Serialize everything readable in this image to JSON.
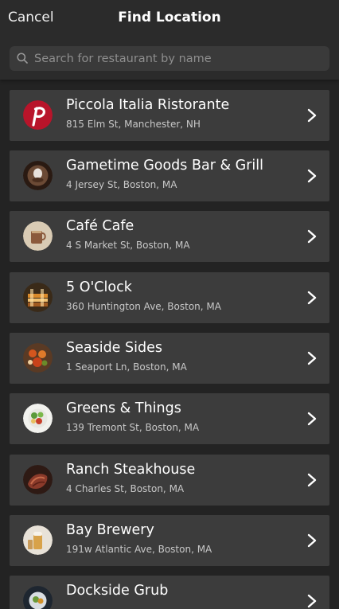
{
  "header": {
    "cancel_label": "Cancel",
    "title": "Find Location"
  },
  "search": {
    "placeholder": "Search for restaurant by name",
    "value": ""
  },
  "restaurants": [
    {
      "name": "Piccola Italia Ristorante",
      "address": "815 Elm St, Manchester, NH",
      "thumb": "logo-p"
    },
    {
      "name": "Gametime Goods Bar & Grill",
      "address": "4 Jersey St, Boston, MA",
      "thumb": "food-photo"
    },
    {
      "name": "Café Cafe",
      "address": "4 S Market St, Boston, MA",
      "thumb": "coffee-photo"
    },
    {
      "name": "5 O'Clock",
      "address": "360 Huntington Ave, Boston, MA",
      "thumb": "drinks-photo"
    },
    {
      "name": "Seaside Sides",
      "address": "1 Seaport Ln, Boston, MA",
      "thumb": "seafood-photo"
    },
    {
      "name": "Greens & Things",
      "address": "139 Tremont St, Boston, MA",
      "thumb": "salad-photo"
    },
    {
      "name": "Ranch Steakhouse",
      "address": "4 Charles St, Boston, MA",
      "thumb": "steak-photo"
    },
    {
      "name": "Bay Brewery",
      "address": "191w Atlantic Ave, Boston, MA",
      "thumb": "beer-photo"
    },
    {
      "name": "Dockside Grub",
      "address": "",
      "thumb": "grub-photo"
    }
  ],
  "colors": {
    "background": "#232323",
    "header": "#2b2b2b",
    "row": "#3c3c3c",
    "brand_red": "#b8142a"
  }
}
